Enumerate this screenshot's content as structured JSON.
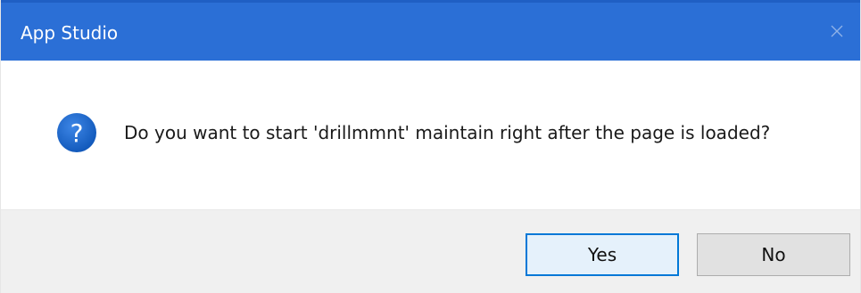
{
  "window": {
    "title": "App Studio",
    "close_icon": "close-icon"
  },
  "dialog": {
    "icon": "question-icon",
    "message": "Do you want to start 'drillmmnt' maintain right after the page is loaded?"
  },
  "buttons": {
    "yes_label": "Yes",
    "no_label": "No"
  },
  "colors": {
    "title_bar": "#2b6fd6",
    "default_button_border": "#0078d7",
    "icon_fill": "#1a63c7",
    "footer_background": "#f0f0f0"
  }
}
